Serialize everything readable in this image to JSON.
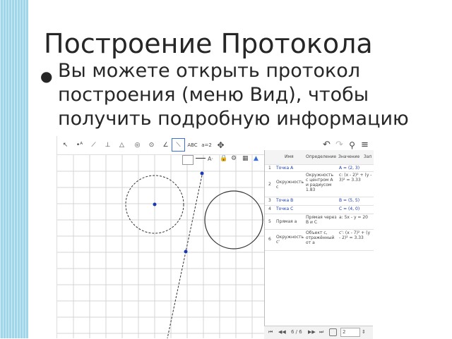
{
  "slide": {
    "title": "Построение Протокола",
    "bullet": "Вы можете открыть протокол построения (меню Вид), чтобы получить подробную информацию"
  },
  "toolbar": {
    "text_tool_label": "ABC",
    "slider_tool_label": "a=2"
  },
  "graphics": {
    "style_label": "A·"
  },
  "protocol": {
    "headers": [
      "Имя",
      "Определение",
      "Значение",
      "Зап"
    ],
    "rows": [
      {
        "num": "1",
        "name": "Точка A",
        "def": "",
        "value": "A = (2, 3)"
      },
      {
        "num": "2",
        "name": "Окружность c",
        "def": "Окружность с центром A и радиусом 1.83",
        "value": "c: (x - 2)² + (y - 3)² = 3.33"
      },
      {
        "num": "3",
        "name": "Точка B",
        "def": "",
        "value": "B = (5, 5)"
      },
      {
        "num": "4",
        "name": "Точка C",
        "def": "",
        "value": "C = (4, 0)"
      },
      {
        "num": "5",
        "name": "Прямая a",
        "def": "Прямая через B и C",
        "value": "a: 5x - y = 20"
      },
      {
        "num": "6",
        "name": "Окружность c'",
        "def": "Объект c, отражённый от a",
        "value": "c': (x - 7)² + (y - 2)² = 3.33"
      }
    ]
  },
  "navbar": {
    "page": "6 / 6",
    "speed": "2"
  }
}
